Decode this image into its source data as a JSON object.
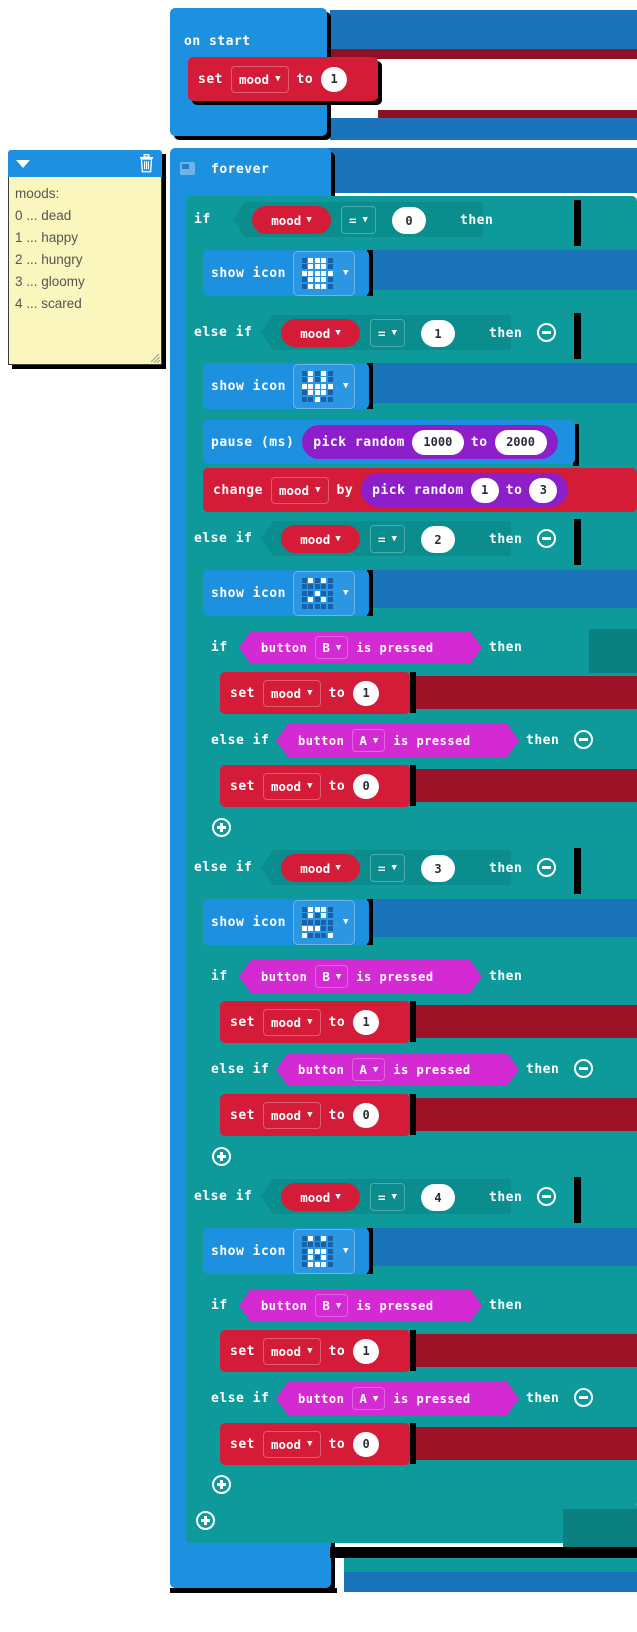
{
  "editor": {
    "app": "microbit-makecode-blocks",
    "background": "#ffffff"
  },
  "comment": {
    "title_icon": "chevron-down-icon",
    "delete_icon": "trash-icon",
    "lines": [
      "moods:",
      "0 ... dead",
      "1 ... happy",
      "2 ... hungry",
      "3 ... gloomy",
      "4 ... scared"
    ]
  },
  "on_start": {
    "label": "on start",
    "set_block": {
      "verb": "set",
      "variable": "mood",
      "to": "to",
      "value": "1"
    }
  },
  "forever": {
    "label": "forever",
    "comment_icon": "comment-icon"
  },
  "keywords": {
    "if": "if",
    "else_if": "else if",
    "then": "then",
    "set": "set",
    "to": "to",
    "by": "by",
    "change": "change",
    "show_icon": "show icon",
    "pause": "pause (ms)",
    "pick_random": "pick random",
    "button": "button",
    "is_pressed": "is pressed",
    "equals": "=",
    "variable": "mood"
  },
  "branches": [
    {
      "kind": "if",
      "left": "mood",
      "op": "=",
      "right": "0",
      "then": "then",
      "has_minus": false
    },
    {
      "kind": "else if",
      "left": "mood",
      "op": "=",
      "right": "1",
      "then": "then",
      "has_minus": true
    },
    {
      "kind": "else if",
      "left": "mood",
      "op": "=",
      "right": "2",
      "then": "then",
      "has_minus": true
    },
    {
      "kind": "else if",
      "left": "mood",
      "op": "=",
      "right": "3",
      "then": "then",
      "has_minus": true
    },
    {
      "kind": "else if",
      "left": "mood",
      "op": "=",
      "right": "4",
      "then": "then",
      "has_minus": true
    }
  ],
  "show_icons": [
    {
      "for_mood": "0",
      "name": "skull-icon",
      "pattern": "0111001110111110111001110"
    },
    {
      "for_mood": "1",
      "name": "happy-icon",
      "pattern": "0101001010111110111000100"
    },
    {
      "for_mood": "2",
      "name": "hungry-icon",
      "pattern": "0101000000001000101000000"
    },
    {
      "for_mood": "3",
      "name": "gloomy-icon",
      "pattern": "0111001010000001110010001"
    },
    {
      "for_mood": "4",
      "name": "scared-icon",
      "pattern": "0101000000011100101001110"
    }
  ],
  "pause_block": {
    "label": "pause (ms)",
    "random_label": "pick random",
    "min": "1000",
    "to": "to",
    "max": "2000"
  },
  "change_block": {
    "label": "change",
    "variable": "mood",
    "by": "by",
    "random_label": "pick random",
    "min": "1",
    "to": "to",
    "max": "3"
  },
  "button_groups": [
    {
      "for_mood": "2",
      "if_label": "if",
      "button_label": "button",
      "button": "B",
      "pressed": "is pressed",
      "then": "then",
      "set": {
        "verb": "set",
        "variable": "mood",
        "to": "to",
        "value": "1"
      },
      "else_if_label": "else if",
      "else_button": "A",
      "else_then": "then",
      "else_set": {
        "verb": "set",
        "variable": "mood",
        "to": "to",
        "value": "0"
      },
      "add_icon": "plus-circle-icon"
    },
    {
      "for_mood": "3",
      "if_label": "if",
      "button_label": "button",
      "button": "B",
      "pressed": "is pressed",
      "then": "then",
      "set": {
        "verb": "set",
        "variable": "mood",
        "to": "to",
        "value": "1"
      },
      "else_if_label": "else if",
      "else_button": "A",
      "else_then": "then",
      "else_set": {
        "verb": "set",
        "variable": "mood",
        "to": "to",
        "value": "0"
      },
      "add_icon": "plus-circle-icon"
    },
    {
      "for_mood": "4",
      "if_label": "if",
      "button_label": "button",
      "button": "B",
      "pressed": "is pressed",
      "then": "then",
      "set": {
        "verb": "set",
        "variable": "mood",
        "to": "to",
        "value": "1"
      },
      "else_if_label": "else if",
      "else_button": "A",
      "else_then": "then",
      "else_set": {
        "verb": "set",
        "variable": "mood",
        "to": "to",
        "value": "0"
      },
      "add_icon": "plus-circle-icon"
    }
  ],
  "outer_add": {
    "icon": "plus-circle-icon"
  },
  "colors": {
    "event_blue": "#1e90e0",
    "logic_teal": "#0e9a9a",
    "variable_red": "#d41c38",
    "math_purple": "#8c1fc9",
    "input_magenta": "#d42ad4",
    "basic_blue": "#1e90e0",
    "note_yellow": "#faf6bd",
    "shadow_black": "#000000"
  }
}
